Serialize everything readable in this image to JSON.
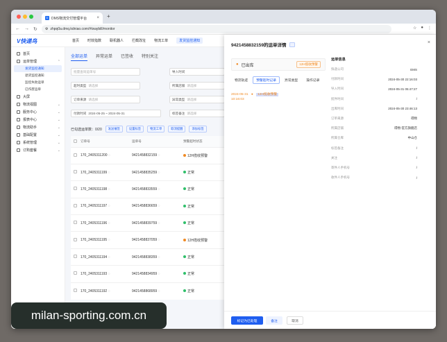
{
  "browser": {
    "tab_title": "DMS物流交付管理平台",
    "url": "zhpq0a.dmq.kdniao.com/#/waybill/monitor"
  },
  "app": {
    "logo": "V快递鸟",
    "topnav": [
      "首页",
      "时效指数",
      "联机器人",
      "拦截改址",
      "物流工单",
      "发货监控通知"
    ],
    "topnav_active": "发货监控通知",
    "sidebar": {
      "items": [
        {
          "label": "首页",
          "chevron": ""
        },
        {
          "label": "运单管理",
          "chevron": "⌃"
        }
      ],
      "subitems": [
        "发货监控通知",
        "退货监控通知",
        "监控失败运单",
        "已作废运单"
      ],
      "items2": [
        {
          "label": "大屏",
          "chevron": ""
        },
        {
          "label": "物流视图",
          "chevron": "⌄"
        },
        {
          "label": "服务中心",
          "chevron": "⌄"
        },
        {
          "label": "报表中心",
          "chevron": "⌄"
        },
        {
          "label": "物流助手",
          "chevron": "⌄"
        },
        {
          "label": "基础配置",
          "chevron": "⌄"
        },
        {
          "label": "系统管理",
          "chevron": "⌄"
        },
        {
          "label": "订购套餐",
          "chevron": "⌄"
        }
      ]
    }
  },
  "main": {
    "tabs": [
      "全部运单",
      "异常运单",
      "已签收",
      "特别关注"
    ],
    "filters": [
      {
        "label": "",
        "placeholder": "批量查询运单号"
      },
      {
        "label": "导入时间",
        "placeholder": ""
      },
      {
        "label": "超时类型",
        "placeholder": "请选择"
      },
      {
        "label": "所属店铺",
        "placeholder": "请选择"
      },
      {
        "label": "订单来源",
        "placeholder": "请选择"
      },
      {
        "label": "异常类型",
        "placeholder": "请选择"
      },
      {
        "label": "付款时间",
        "placeholder": "2024-05-25 ~ 2024-05-31"
      },
      {
        "label": "标签备注",
        "placeholder": "请选择"
      }
    ],
    "list_title": "已勾选运单数：0/20",
    "chips": [
      "发送催签",
      "设置标签",
      "物流工单",
      "取消提醒",
      "添加标签"
    ],
    "table": {
      "headers": [
        "订单号",
        "运单号",
        "预警超时状态"
      ],
      "rows": [
        {
          "order": "170_2405311200",
          "waybill": "9421458832159",
          "status": "12H揽收预警",
          "kind": "warn"
        },
        {
          "order": "170_2405311199",
          "waybill": "9421458835259",
          "status": "正常",
          "kind": "ok"
        },
        {
          "order": "170_2405311198",
          "waybill": "9421458833559",
          "status": "正常",
          "kind": "ok"
        },
        {
          "order": "170_2405311197",
          "waybill": "9421458836659",
          "status": "正常",
          "kind": "ok"
        },
        {
          "order": "170_2405311196",
          "waybill": "9421458839759",
          "status": "正常",
          "kind": "ok"
        },
        {
          "order": "170_2405311195",
          "waybill": "9421458837059",
          "status": "12H揽收预警",
          "kind": "warn"
        },
        {
          "order": "170_2405311194",
          "waybill": "9421458838359",
          "status": "正常",
          "kind": "ok"
        },
        {
          "order": "170_2405311193",
          "waybill": "9421458834959",
          "status": "正常",
          "kind": "ok"
        },
        {
          "order": "170_2405311192",
          "waybill": "9421458868959",
          "status": "正常",
          "kind": "ok"
        }
      ]
    }
  },
  "panel": {
    "title": "9421458832159的运单详情",
    "status": "已出库",
    "status_badge": "12H揽收预警",
    "tabs": [
      "物流轨迹",
      "预警超时记录",
      "异常类型",
      "操作记录"
    ],
    "timeline": {
      "date": "2024-05-31",
      "time": "10:16:03",
      "text": "12H揽收预警"
    },
    "info_title": "运单信息",
    "info": [
      {
        "k": "快递公司",
        "v": "EMS"
      },
      {
        "k": "付款时间",
        "v": "2024-05-30 22:16:03"
      },
      {
        "k": "导入时间",
        "v": "2024-05-31 05:47:27"
      },
      {
        "k": "揽件时间",
        "v": "/"
      },
      {
        "k": "出库时间",
        "v": "2024-05-30 23:46:13"
      },
      {
        "k": "订单来源",
        "v": "得物"
      },
      {
        "k": "所属店铺",
        "v": "得物-官方旗舰店"
      },
      {
        "k": "所属仓库",
        "v": "中山仓"
      },
      {
        "k": "标签备注",
        "v": "/"
      },
      {
        "k": "关注",
        "v": "/"
      },
      {
        "k": "寄件人手机号",
        "v": "/"
      },
      {
        "k": "收件人手机号",
        "v": "/"
      }
    ],
    "buttons": {
      "primary": "标记为已处理",
      "secondary": "备注",
      "cancel": "取消"
    }
  },
  "watermark": "milan-sporting.com.cn"
}
